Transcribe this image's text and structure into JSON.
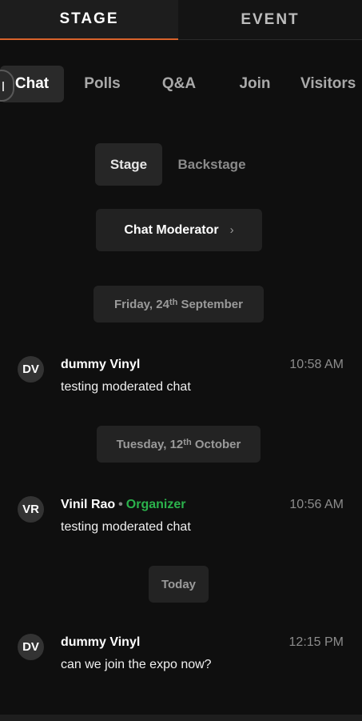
{
  "top_tabs": [
    {
      "label": "STAGE",
      "active": true
    },
    {
      "label": "EVENT",
      "active": false
    }
  ],
  "sub_nav": [
    {
      "label": "Chat",
      "active": true
    },
    {
      "label": "Polls"
    },
    {
      "label": "Q&A"
    },
    {
      "label": "Join"
    },
    {
      "label": "Visitors"
    }
  ],
  "segments": {
    "stage": "Stage",
    "backstage": "Backstage"
  },
  "moderator_button": {
    "label": "Chat Moderator",
    "chevron": "›"
  },
  "date_pills": [
    {
      "prefix": "Friday, 24",
      "sup": "th",
      "suffix": " September"
    },
    {
      "prefix": "Tuesday, 12",
      "sup": "th",
      "suffix": " October"
    },
    {
      "prefix": "Today",
      "sup": "",
      "suffix": ""
    }
  ],
  "messages": [
    {
      "initials": "DV",
      "name": "dummy Vinyl",
      "role": "",
      "text": "testing moderated chat",
      "time": "10:58 AM"
    },
    {
      "initials": "VR",
      "name": "Vinil Rao",
      "role": "Organizer",
      "separator": "•",
      "text": "testing moderated chat",
      "time": "10:56 AM"
    },
    {
      "initials": "DV",
      "name": "dummy Vinyl",
      "role": "",
      "text": "can we join the expo now?",
      "time": "12:15 PM"
    }
  ],
  "colors": {
    "accent": "#d9622b",
    "organizer": "#2bb24c",
    "background": "#0f0f0f"
  }
}
